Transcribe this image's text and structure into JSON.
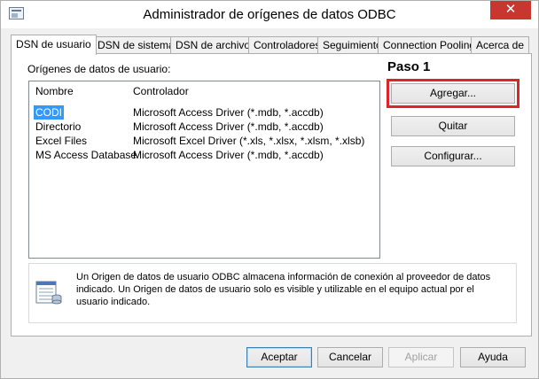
{
  "window": {
    "title": "Administrador de orígenes de datos ODBC",
    "close_glyph": "✕"
  },
  "tabs": [
    {
      "label": "DSN de usuario",
      "active": true
    },
    {
      "label": "DSN de sistema",
      "active": false
    },
    {
      "label": "DSN de archivo",
      "active": false
    },
    {
      "label": "Controladores",
      "active": false
    },
    {
      "label": "Seguimiento",
      "active": false
    },
    {
      "label": "Connection Pooling",
      "active": false
    },
    {
      "label": "Acerca de",
      "active": false
    }
  ],
  "panel": {
    "section_label": "Orígenes de datos de usuario:",
    "annotation": "Paso 1",
    "highlight_color": "#e0222b",
    "columns": [
      "Nombre",
      "Controlador"
    ],
    "rows": [
      {
        "name": "CODI",
        "driver": "Microsoft Access Driver (*.mdb, *.accdb)",
        "selected": true
      },
      {
        "name": "Directorio",
        "driver": "Microsoft Access Driver (*.mdb, *.accdb)",
        "selected": false
      },
      {
        "name": "Excel Files",
        "driver": "Microsoft Excel Driver (*.xls, *.xlsx, *.xlsm, *.xlsb)",
        "selected": false
      },
      {
        "name": "MS Access Database",
        "driver": "Microsoft Access Driver (*.mdb, *.accdb)",
        "selected": false
      }
    ],
    "buttons": {
      "add": "Agregar...",
      "remove": "Quitar",
      "configure": "Configurar..."
    },
    "info_text": "Un Origen de datos de usuario ODBC almacena información de conexión al proveedor de datos indicado. Un Origen de datos de usuario solo es visible y utilizable en el equipo actual por el usuario indicado.",
    "info_icon": "database-document-icon"
  },
  "footer": {
    "ok": "Aceptar",
    "cancel": "Cancelar",
    "apply": "Aplicar",
    "help": "Ayuda"
  }
}
